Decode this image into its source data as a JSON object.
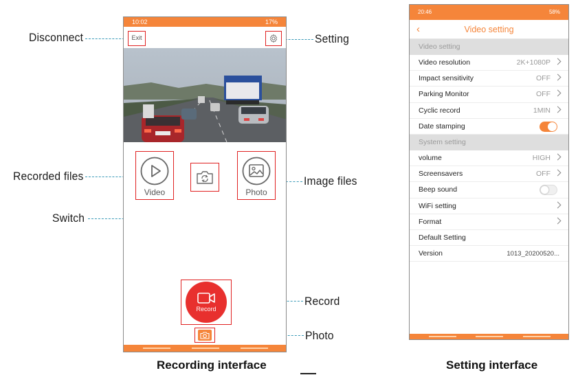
{
  "left_phone": {
    "status_time": "10:02",
    "status_right": "17%",
    "exit_label": "Exit",
    "video_label": "Video",
    "photo_label": "Photo",
    "record_label": "Record"
  },
  "right_phone": {
    "status_time": "20:46",
    "status_right": "58%",
    "title": "Video setting",
    "sections": [
      {
        "title": "Video setting",
        "rows": [
          {
            "label": "Video resolution",
            "value": "2K+1080P",
            "kind": "chevron"
          },
          {
            "label": "Impact sensitivity",
            "value": "OFF",
            "kind": "chevron"
          },
          {
            "label": "Parking Monitor",
            "value": "OFF",
            "kind": "chevron"
          },
          {
            "label": "Cyclic record",
            "value": "1MIN",
            "kind": "chevron"
          },
          {
            "label": "Date stamping",
            "value": "",
            "kind": "toggle-on"
          }
        ]
      },
      {
        "title": "System setting",
        "rows": [
          {
            "label": "volume",
            "value": "HIGH",
            "kind": "chevron"
          },
          {
            "label": "Screensavers",
            "value": "OFF",
            "kind": "chevron"
          },
          {
            "label": "Beep sound",
            "value": "",
            "kind": "toggle-off"
          },
          {
            "label": "WiFi setting",
            "value": "",
            "kind": "chevron"
          },
          {
            "label": "Format",
            "value": "",
            "kind": "chevron"
          },
          {
            "label": "Default Setting",
            "value": "",
            "kind": "none"
          },
          {
            "label": "Version",
            "value": "1013_20200520...",
            "kind": "version"
          }
        ]
      }
    ]
  },
  "callouts": {
    "disconnect": "Disconnect",
    "setting": "Setting",
    "recorded_files": "Recorded files",
    "image_files": "Image files",
    "switch": "Switch",
    "record": "Record",
    "photo": "Photo"
  },
  "captions": {
    "left": "Recording interface",
    "right": "Setting interface"
  },
  "colors": {
    "accent_orange": "#f5853a",
    "record_red": "#e8302e",
    "highlight_red": "#e02020",
    "leader_blue": "#3a9ab8"
  }
}
